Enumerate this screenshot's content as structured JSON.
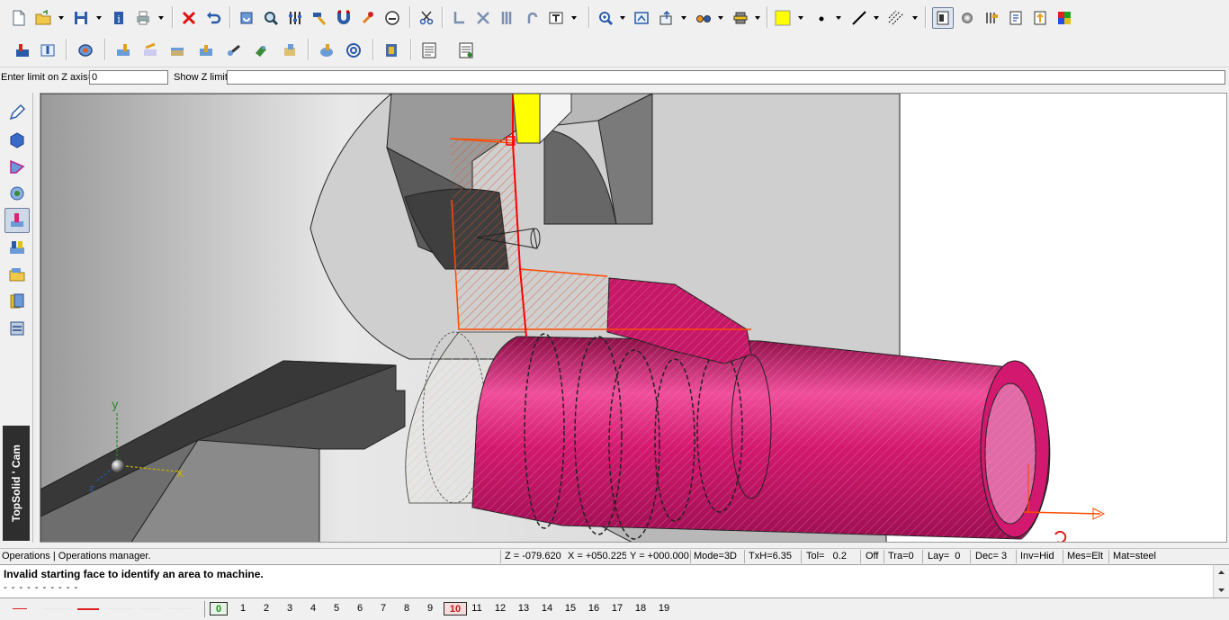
{
  "z_limit": {
    "label": "Enter limit on Z axis=",
    "value": "0",
    "show_label": "Show Z limit"
  },
  "toolbar1_icons": [
    "new-file-icon",
    "open-folder-icon",
    "save-icon",
    "info-icon",
    "print-icon",
    "delete-icon",
    "undo-icon",
    "regenerate-icon",
    "zoom-magnifier-icon",
    "sliders-icon",
    "hammer-icon",
    "magnet-icon",
    "wrench-tool-icon",
    "gauge-icon",
    "scissors-icon",
    "edge-select-icon",
    "cross-cut-icon",
    "hatch-lines-icon",
    "arc-icon",
    "text-box-icon",
    "zoom-in-icon",
    "fit-window-icon",
    "export-view-icon",
    "glasses-icon",
    "render-mode-icon",
    "color-swatch-icon",
    "point-style-icon",
    "line-style-icon",
    "hatch-style-icon",
    "properties-panel-icon",
    "hidden-gear-icon",
    "parameters-icon",
    "book-icon",
    "arrow-up-doc-icon",
    "color-map-icon"
  ],
  "toolbar2_icons": [
    "machine-setup-icon",
    "tool-path-icon",
    "stock-icon",
    "facing-op-icon",
    "roughing-op-icon",
    "finishing-op-icon",
    "grooving-op-icon",
    "threading-op-icon",
    "drilling-op-icon",
    "parting-op-icon",
    "simulation-icon",
    "target-icon",
    "tool-library-icon",
    "nc-code-icon",
    "nc-code-run-icon"
  ],
  "sidebar_icons": [
    "sketch-pencil-icon",
    "solid-box-icon",
    "surface-design-icon",
    "assembly-icon",
    "cam-mode-icon",
    "machining-ops-icon",
    "folder-icon",
    "documents-icon",
    "tools-cabinet-icon"
  ],
  "brand_label": "TopSolid ' Cam",
  "viewport": {
    "axis_x": "x",
    "axis_y": "y",
    "axis_z": "z"
  },
  "status": {
    "left": "Operations | Operations manager.",
    "z": "Z = -079.620",
    "x": "X = +050.225",
    "y": "Y = +000.000",
    "mode": "Mode=3D",
    "txh": "TxH=6.35",
    "tol": "Tol=   0.2",
    "off": "Off",
    "tra": "Tra=0",
    "lay": "Lay=  0",
    "dec": "Dec= 3",
    "inv": "Inv=Hid",
    "mes": "Mes=Elt",
    "mat": "Mat=steel"
  },
  "messages": {
    "line1": "Invalid starting face to identify an area to machine.",
    "line2": "- - - - - - - - - -"
  },
  "layers": [
    "0",
    "1",
    "2",
    "3",
    "4",
    "5",
    "6",
    "7",
    "8",
    "9",
    "10",
    "11",
    "12",
    "13",
    "14",
    "15",
    "16",
    "17",
    "18",
    "19"
  ],
  "colors": {
    "part": "#d3196f",
    "toolpath": "#ff4b00",
    "highlight": "#ffff00",
    "chuck_dark": "#4e4e4e"
  }
}
